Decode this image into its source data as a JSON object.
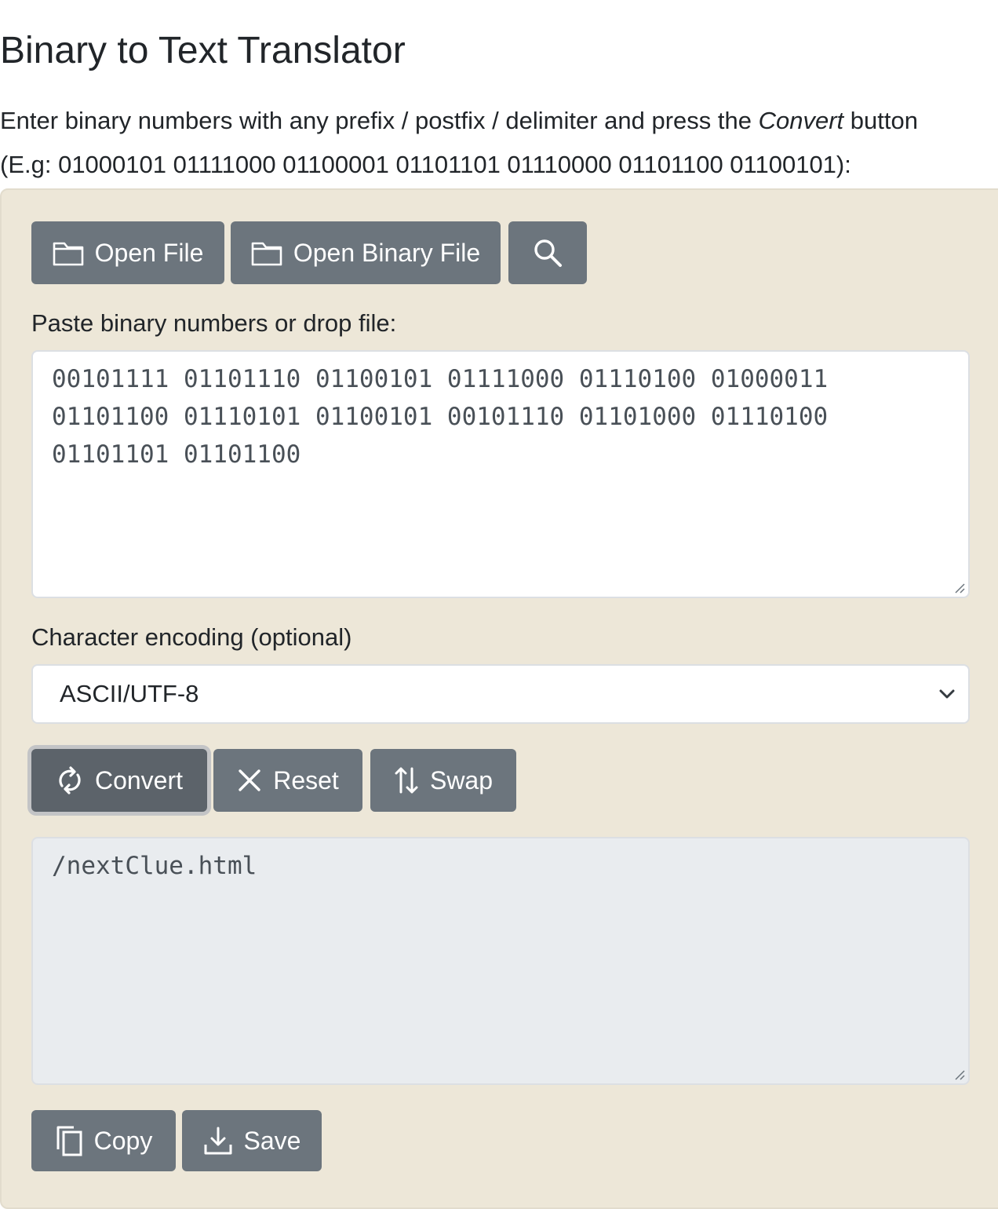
{
  "page": {
    "title": "Binary to Text Translator",
    "intro_before": "Enter binary numbers with any prefix / postfix / delimiter and press the ",
    "intro_emphasis": "Convert",
    "intro_after": " button",
    "intro_example": "(E.g: 01000101 01111000 01100001 01101101 01110000 01101100 01100101):"
  },
  "toolbar": {
    "open_file_label": "Open File",
    "open_binary_file_label": "Open Binary File",
    "search_icon": "search-icon"
  },
  "input": {
    "label": "Paste binary numbers or drop file:",
    "value": "00101111 01101110 01100101 01111000 01110100 01000011\n01101100 01110101 01100101 00101110 01101000 01110100\n01101101 01101100"
  },
  "encoding": {
    "label": "Character encoding (optional)",
    "selected": "ASCII/UTF-8"
  },
  "actions": {
    "convert_label": "Convert",
    "reset_label": "Reset",
    "swap_label": "Swap"
  },
  "output": {
    "value": "/nextClue.html"
  },
  "output_actions": {
    "copy_label": "Copy",
    "save_label": "Save"
  },
  "colors": {
    "panel_bg": "#ede7d8",
    "button_bg": "#6c757d",
    "button_active_bg": "#5c636a",
    "readonly_bg": "#e9ecef"
  }
}
